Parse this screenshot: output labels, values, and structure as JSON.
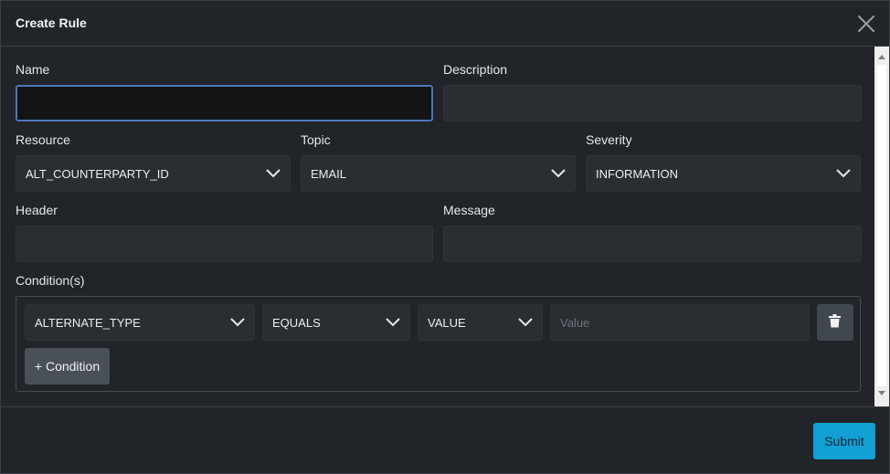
{
  "dialog": {
    "title": "Create Rule",
    "close_icon": "close-icon"
  },
  "form": {
    "name": {
      "label": "Name",
      "value": ""
    },
    "description": {
      "label": "Description",
      "value": ""
    },
    "resource": {
      "label": "Resource",
      "value": "ALT_COUNTERPARTY_ID"
    },
    "topic": {
      "label": "Topic",
      "value": "EMAIL"
    },
    "severity": {
      "label": "Severity",
      "value": "INFORMATION"
    },
    "header": {
      "label": "Header",
      "value": ""
    },
    "message": {
      "label": "Message",
      "value": ""
    },
    "conditions": {
      "label": "Condition(s)",
      "rows": [
        {
          "field": "ALTERNATE_TYPE",
          "operator": "EQUALS",
          "type": "VALUE",
          "value": "",
          "value_placeholder": "Value"
        }
      ],
      "add_label": "+ Condition"
    }
  },
  "footer": {
    "submit_label": "Submit"
  },
  "colors": {
    "accent": "#12a0d4",
    "focus_border": "#5b6ec9",
    "dialog_bg": "#212428"
  },
  "icons": [
    "close-icon",
    "chevron-down-icon",
    "trash-icon"
  ]
}
